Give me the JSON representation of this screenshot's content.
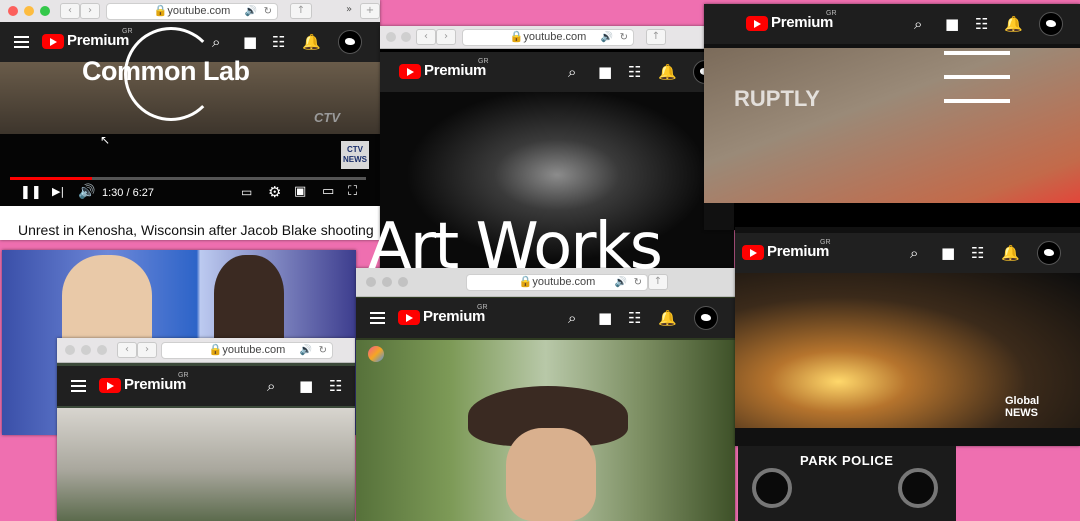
{
  "browser": {
    "url": "youtube.com"
  },
  "youtube": {
    "brand": "Premium",
    "region": "GR"
  },
  "overlay": {
    "common_lab": "Common Lab",
    "art_works": "Art Works"
  },
  "player": {
    "time": "1:30 / 6:27",
    "progress": 0.23,
    "channel_watermark": "CTV",
    "news_badge": "CTV NEWS"
  },
  "video_caption": "Unrest in Kenosha, Wisconsin after Jacob Blake shooting",
  "scenes": {
    "ruptly_watermark": "RUPTLY",
    "global_news": "Global NEWS",
    "park_police": "PARK POLICE"
  },
  "colors": {
    "accent": "#ff0000",
    "background": "#ef6fb0",
    "youtube_bar": "#202020"
  },
  "icons": [
    "menu-icon",
    "youtube-logo-icon",
    "search-icon",
    "video-camera-icon",
    "apps-grid-icon",
    "bell-icon",
    "avatar-icon",
    "play-pause-icon",
    "next-icon",
    "volume-icon",
    "subtitles-icon",
    "settings-icon",
    "miniplayer-icon",
    "theater-icon",
    "fullscreen-icon"
  ]
}
